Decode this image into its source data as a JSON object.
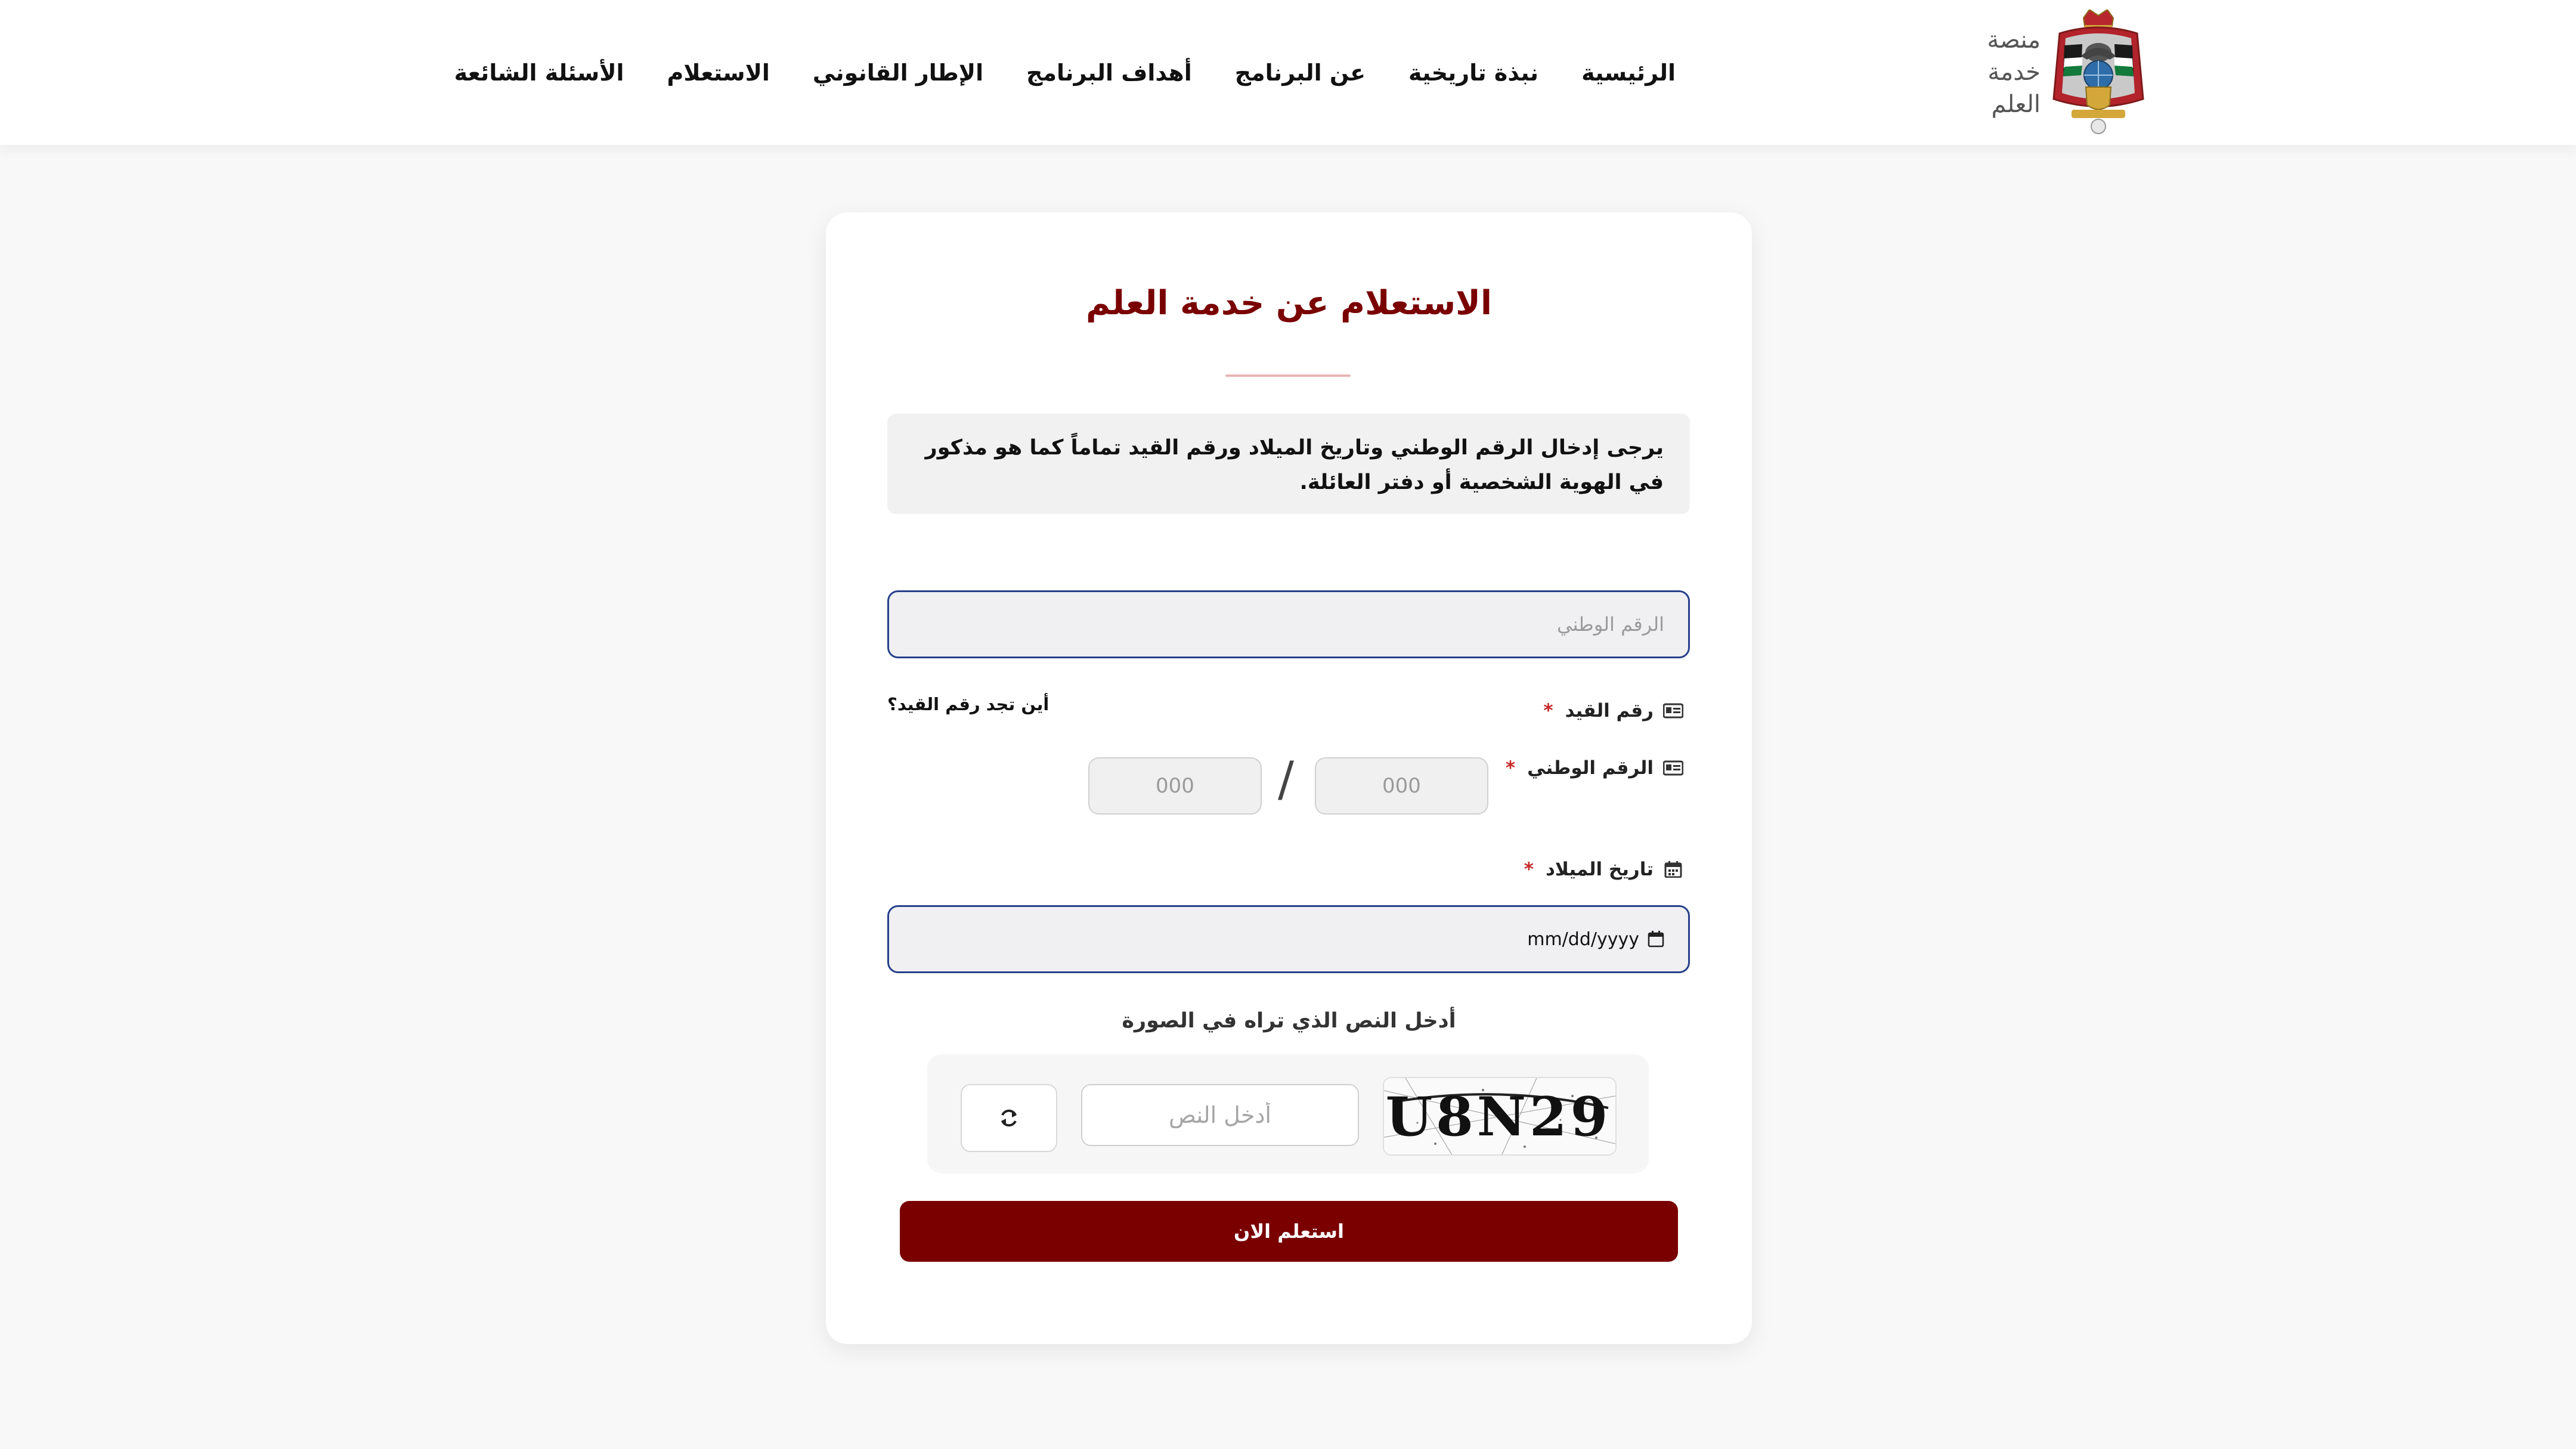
{
  "brand": {
    "name_lines": [
      "منصة",
      "خدمة",
      "العلم"
    ],
    "emblem_icon": "jordan-coat-of-arms-icon"
  },
  "nav": {
    "items": [
      {
        "label": "الرئيسية"
      },
      {
        "label": "نبذة تاريخية"
      },
      {
        "label": "عن البرنامج"
      },
      {
        "label": "أهداف البرنامج"
      },
      {
        "label": "الإطار القانوني"
      },
      {
        "label": "الاستعلام"
      },
      {
        "label": "الأسئلة الشائعة"
      }
    ]
  },
  "form": {
    "title": "الاستعلام عن خدمة العلم",
    "notice": "يرجى إدخال الرقم الوطني وتاريخ الميلاد ورقم القيد تماماً كما هو مذكور في الهوية الشخصية أو دفتر العائلة.",
    "national_id": {
      "label": "الرقم الوطني",
      "required_mark": "*",
      "placeholder": "الرقم الوطني",
      "value": "",
      "icon": "id-card-icon"
    },
    "registry_number": {
      "label": "رقم القيد",
      "required_mark": "*",
      "help_link": "أين تجد رقم القيد؟",
      "part1_placeholder": "000",
      "part2_placeholder": "000",
      "separator": "/",
      "icon": "id-card-icon"
    },
    "birth_date": {
      "label": "تاريخ الميلاد",
      "required_mark": "*",
      "placeholder": "mm/dd/yyyy",
      "icon": "calendar-icon"
    },
    "captcha": {
      "label": "أدخل النص الذي تراه في الصورة",
      "image_text": "U8N29",
      "input_placeholder": "أدخل النص",
      "refresh_icon": "refresh-icon"
    },
    "submit_label": "استعلم الان"
  },
  "colors": {
    "brand_dark_red": "#7a0000",
    "focus_border": "#27408b",
    "required": "#c62828",
    "page_background": "#f8f8f8"
  }
}
